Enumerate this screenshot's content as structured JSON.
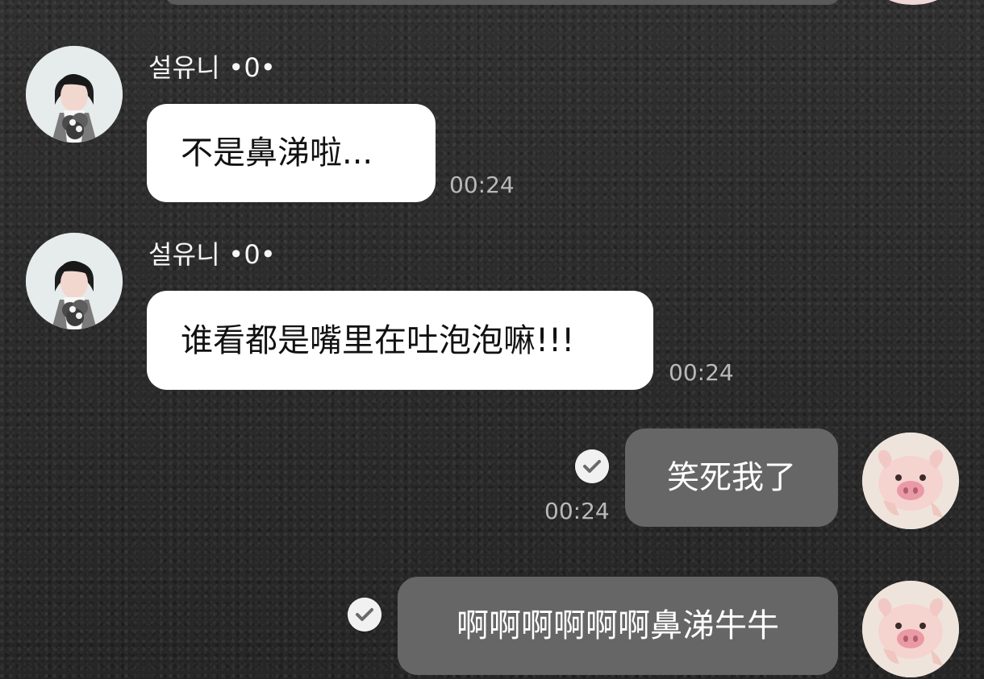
{
  "chat": {
    "messages": [
      {
        "sender_name": "설유니 •0•",
        "text": "不是鼻涕啦...",
        "time": "00:24"
      },
      {
        "sender_name": "설유니 •0•",
        "text": "谁看都是嘴里在吐泡泡嘛!!!",
        "time": "00:24"
      },
      {
        "text": "笑死我了",
        "time": "00:24",
        "status_icon": "check-icon"
      },
      {
        "text": "啊啊啊啊啊啊鼻涕牛牛",
        "status_icon": "check-icon"
      }
    ]
  },
  "colors": {
    "background": "#2d2d2d",
    "incoming_bubble": "#ffffff",
    "outgoing_bubble": "#666666",
    "timestamp": "#b9b9b9",
    "status_badge": "#f0f0f0"
  }
}
